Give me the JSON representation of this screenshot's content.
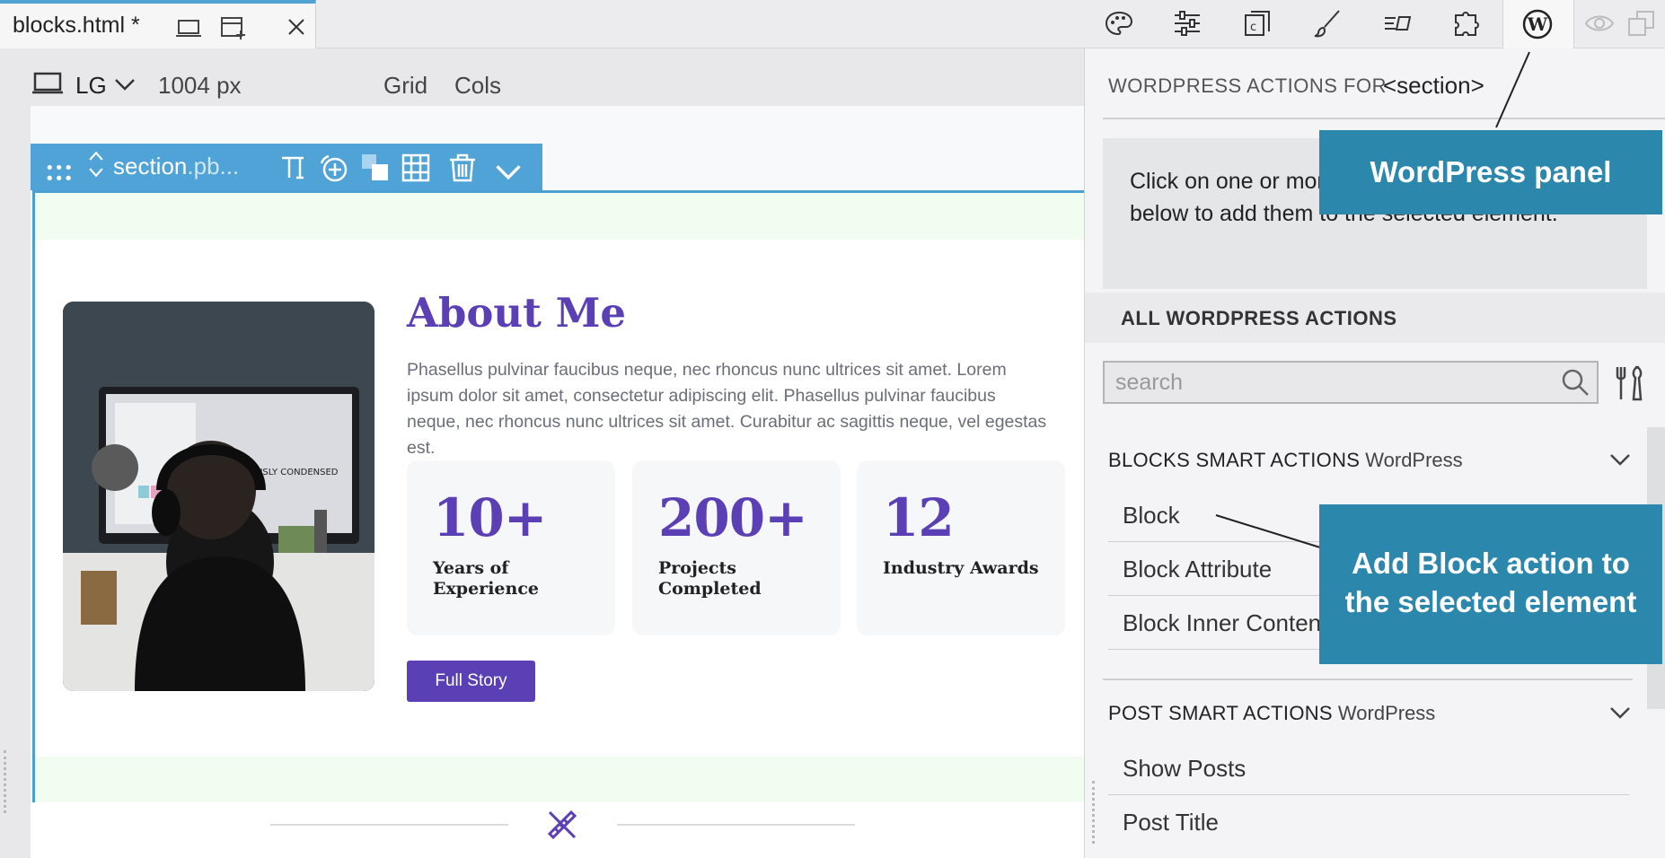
{
  "tab": {
    "title": "blocks.html *"
  },
  "canvas_bar": {
    "breakpoint": "LG",
    "width": "1004 px",
    "grid": "Grid",
    "cols": "Cols"
  },
  "selection": {
    "name": "section",
    "classes": ".pb..."
  },
  "content": {
    "title": "About Me",
    "text": "Phasellus pulvinar faucibus neque, nec rhoncus nunc ultrices sit amet. Lorem ipsum dolor sit amet, consectetur adipiscing elit. Phasellus pulvinar faucibus neque, nec rhoncus nunc ultrices sit amet. Curabitur ac sagittis neque, vel egestas est.",
    "stats": [
      {
        "number": "10+",
        "caption": "Years of Experience"
      },
      {
        "number": "200+",
        "caption": "Projects Completed"
      },
      {
        "number": "12",
        "caption": "Industry Awards"
      }
    ],
    "button": "Full Story",
    "photo_text": "OBVIOUSLY CONDENSED"
  },
  "panel": {
    "heading": "WORDPRESS ACTIONS FOR",
    "selected_element": "<section>",
    "info_text": "Click on one or more actions from the list below to add them to the selected element.",
    "all_actions": "ALL WORDPRESS ACTIONS",
    "search_placeholder": "search",
    "groups": [
      {
        "title": "BLOCKS SMART ACTIONS",
        "source": "WordPress",
        "items": [
          "Block",
          "Block Attribute",
          "Block Inner Content"
        ]
      },
      {
        "title": "POST SMART ACTIONS",
        "source": "WordPress",
        "items": [
          "Show Posts",
          "Post Title"
        ]
      }
    ]
  },
  "callouts": {
    "wordpress_panel": "WordPress panel",
    "add_block": "Add Block action to the selected element"
  },
  "colors": {
    "accent": "#5b3fb5",
    "selection": "#4fa3d6",
    "callout": "#2c87ad",
    "padding_band": "#f1fdf0"
  },
  "icons": [
    "laptop-icon",
    "new-window-icon",
    "close-icon",
    "palette-icon",
    "sliders-icon",
    "components-icon",
    "brush-icon",
    "text-styles-icon",
    "puzzle-icon",
    "wordpress-icon",
    "eye-icon",
    "duplicate-icon",
    "drag-handle-icon",
    "move-updown-icon",
    "text-icon",
    "add-icon",
    "swap-icon",
    "grid-icon",
    "trash-icon",
    "chevron-down-icon",
    "search-icon",
    "tools-icon",
    "design-tool-icon"
  ]
}
